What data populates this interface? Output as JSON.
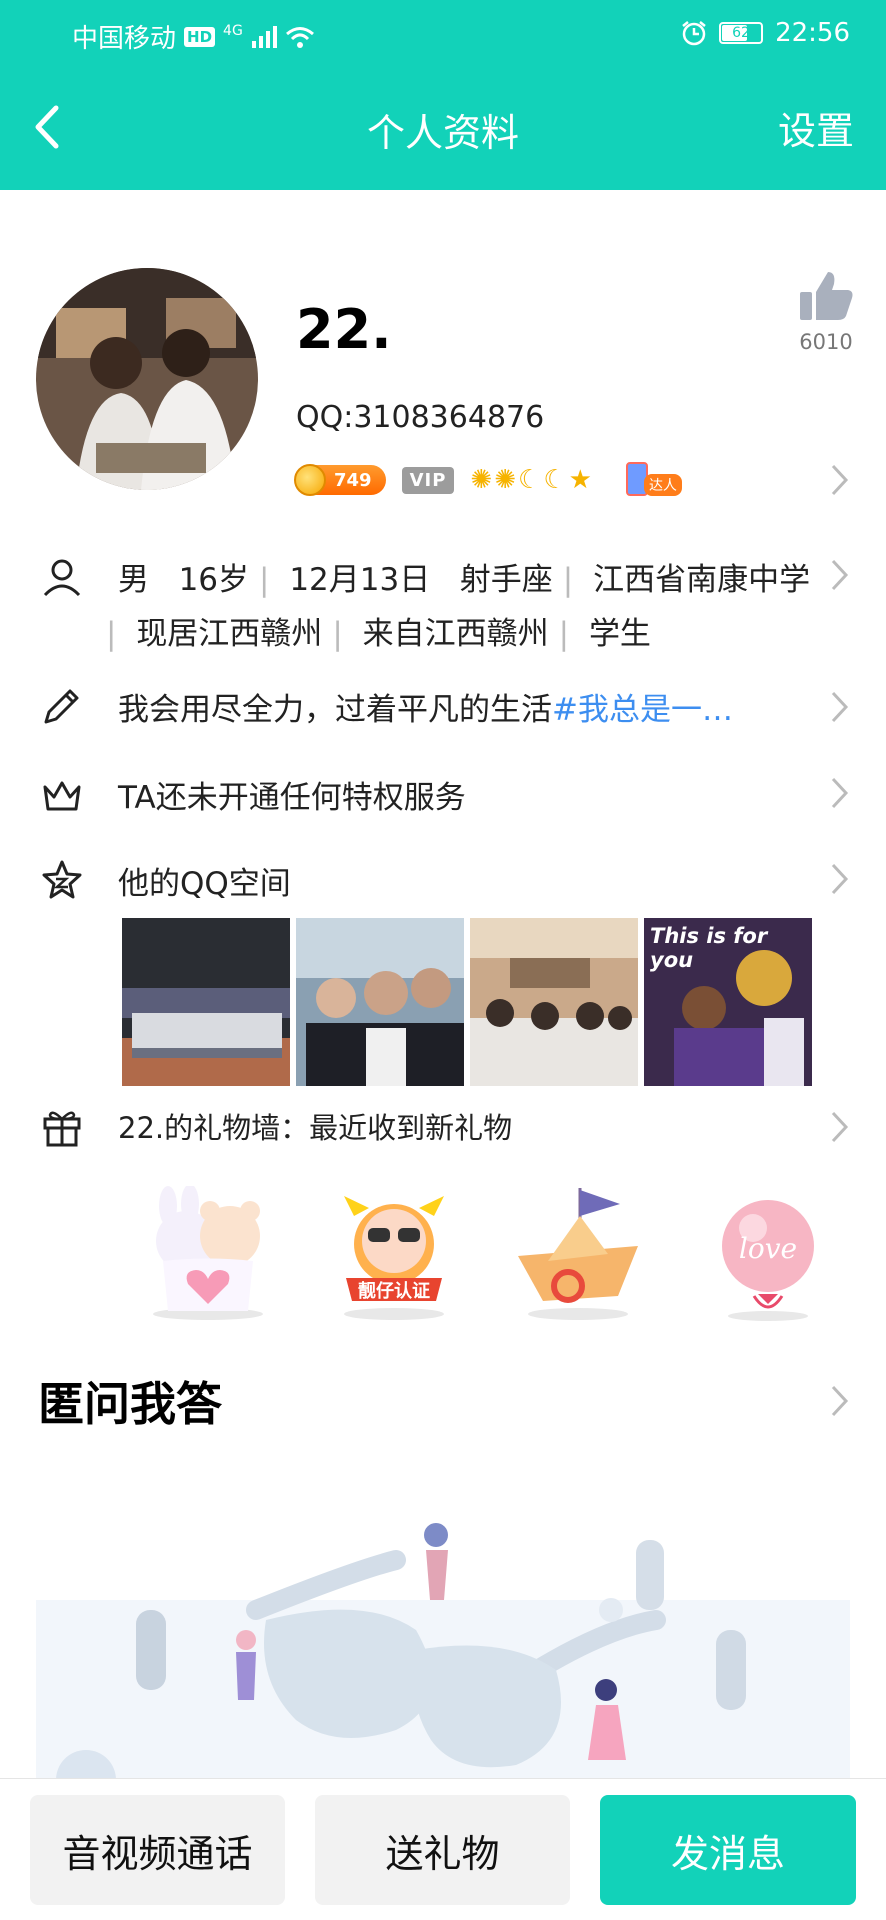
{
  "status_bar": {
    "carrier": "中国移动",
    "hd": "HD",
    "network": "4G",
    "battery": "62",
    "time": "22:56"
  },
  "nav": {
    "title": "个人资料",
    "settings": "设置"
  },
  "profile": {
    "nickname": "22.",
    "qq": "QQ:3108364876",
    "likes": "6010",
    "coins": "749",
    "vip": "VIP",
    "daren": "达人"
  },
  "info": {
    "gender": "男",
    "age": "16岁",
    "birthday": "12月13日",
    "zodiac": "射手座",
    "school": "江西省南康中学",
    "current_city": "现居江西赣州",
    "hometown": "来自江西赣州",
    "occupation": "学生"
  },
  "signature": {
    "text": "我会用尽全力，过着平凡的生活",
    "topic": "#我总是一…"
  },
  "privilege": "TA还未开通任何特权服务",
  "qzone": {
    "label": "他的QQ空间",
    "photo_caption": "This is for you"
  },
  "gift_wall": {
    "label": "22.的礼物墙：最近收到新礼物",
    "gift2_text": "靓仔认证",
    "gift4_text": "love"
  },
  "qa": {
    "title": "匿问我答"
  },
  "bottom_bar": {
    "call": "音视频通话",
    "gift": "送礼物",
    "message": "发消息"
  },
  "colors": {
    "accent": "#12d2b9",
    "link": "#3d8ef0"
  }
}
